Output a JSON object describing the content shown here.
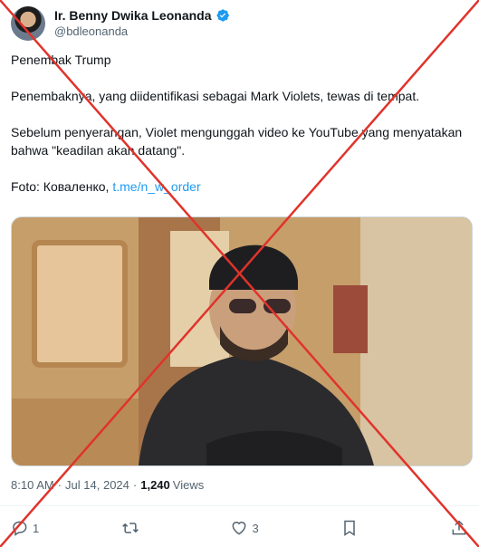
{
  "author": {
    "name": "Ir. Benny Dwika Leonanda",
    "handle": "@bdleonanda"
  },
  "tweet": {
    "line1": "Penembak Trump",
    "line2": "Penembaknya, yang diidentifikasi sebagai Mark Violets, tewas di tempat.",
    "line3": "Sebelum penyerangan, Violet mengunggah video ke YouTube yang menyatakan bahwa \"keadilan akan datang\".",
    "photo_credit_prefix": "Foto: Коваленко, ",
    "photo_credit_link": "t.me/n_w_order"
  },
  "meta": {
    "time": "8:10 AM",
    "date": "Jul 14, 2024",
    "views_count": "1,240",
    "views_label": "Views"
  },
  "actions": {
    "reply_count": "1",
    "repost_count": "",
    "like_count": "3"
  },
  "colors": {
    "link": "#1d9bf0",
    "verified": "#1d9bf0",
    "strike": "#e0332b"
  },
  "icons": [
    "verified-badge-icon",
    "reply-icon",
    "repost-icon",
    "like-icon",
    "bookmark-icon",
    "share-icon"
  ]
}
